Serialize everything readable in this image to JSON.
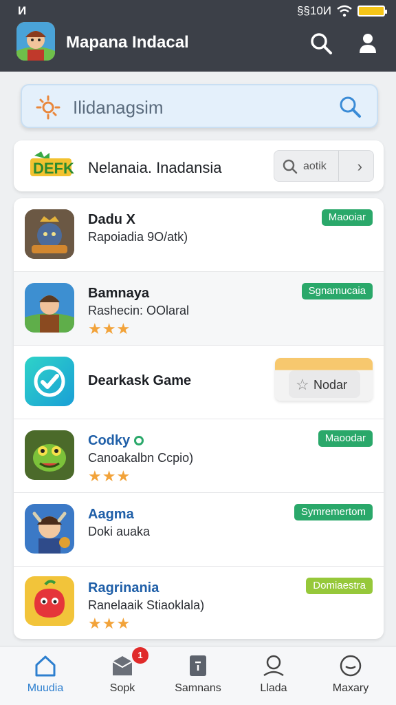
{
  "status": {
    "left": "И",
    "right": "§§10И"
  },
  "app": {
    "title": "Mapana Indacal"
  },
  "search": {
    "placeholder": "Ilidanagsim"
  },
  "featured": {
    "title": "Nelanaia. Inadansia",
    "search_text": "aotik"
  },
  "items": [
    {
      "name": "Dadu X",
      "subtitle": "Rapoiadia 9O/atk)",
      "badge": "Maooiar",
      "badge_color": "#2aa86a"
    },
    {
      "name": "Bamnaya",
      "subtitle": "Rashecin: OOlaral",
      "stars": "★★★",
      "badge": "Sgnamucaia",
      "badge_color": "#2aa86a"
    },
    {
      "name": "Dearkask Game",
      "button": "Nodar"
    },
    {
      "name": "Codky",
      "subtitle": "Canoakalbn Ccpio)",
      "stars": "★★★",
      "badge": "Maoodar",
      "badge_color": "#2aa86a"
    },
    {
      "name": "Aagma",
      "subtitle": "Doki auaka",
      "badge": "Symremertom",
      "badge_color": "#2aa86a"
    },
    {
      "name": "Ragrinania",
      "subtitle": "Ranelaaik Stiaoklala)",
      "stars": "★★★",
      "badge": "Domiaestra",
      "badge_color": "#96c83a"
    }
  ],
  "nav": [
    {
      "label": "Muudia",
      "icon": "home-icon"
    },
    {
      "label": "Sopk",
      "icon": "box-icon",
      "badge": "1"
    },
    {
      "label": "Samnans",
      "icon": "file-icon"
    },
    {
      "label": "Llada",
      "icon": "profile-icon"
    },
    {
      "label": "Maxary",
      "icon": "smiley-icon"
    }
  ]
}
